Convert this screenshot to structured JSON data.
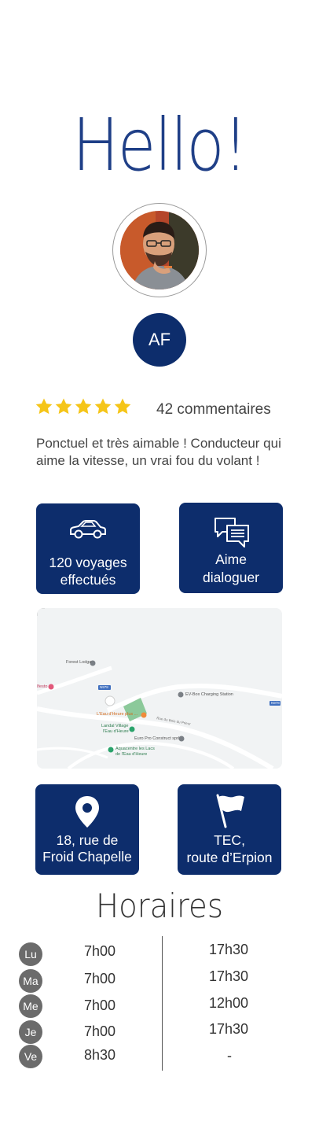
{
  "greeting": "Hello!",
  "profile": {
    "initials": "AF",
    "rating_stars": 5,
    "comments_count": "42 commentaires",
    "review": "Ponctuel et très aimable ! Conducteur qui aime la vitesse, un vrai fou du volant !"
  },
  "stats": {
    "trips_line1": "120 voyages",
    "trips_line2": "effectués",
    "chat_line1": "Aime",
    "chat_line2": "dialoguer"
  },
  "map_labels": {
    "forest_lodge": "Forest Lodge",
    "evbox": "EV-Box Charging Station",
    "eau_heure": "L'Eau d'Heure plus ...",
    "landal": "Landal Village",
    "landal2": "l'Eau d'Heure",
    "euro_pro": "Euro Pro Construct sprl",
    "aquacentre": "Aquacentre les Lacs",
    "aquacentre2": "de l'Eau d'Heure",
    "road_name": "Rue du Bois du Prieur",
    "fast_food": "Ifesto",
    "road_tag1": "N978",
    "road_tag2": "N978"
  },
  "locations": {
    "pickup_line1": "18, rue de",
    "pickup_line2": "Froid Chapelle",
    "dropoff_line1": "TEC,",
    "dropoff_line2": "route d’Erpion"
  },
  "schedule": {
    "title": "Horaires",
    "rows": [
      {
        "day": "Lu",
        "morning": "7h00",
        "evening": "17h30"
      },
      {
        "day": "Ma",
        "morning": "7h00",
        "evening": "17h30"
      },
      {
        "day": "Me",
        "morning": "7h00",
        "evening": "12h00"
      },
      {
        "day": "Je",
        "morning": "7h00",
        "evening": "17h30"
      },
      {
        "day": "Ve",
        "morning": "8h30",
        "evening": "-"
      }
    ]
  },
  "colors": {
    "brand_navy": "#0d2d6c",
    "star_gold": "#f5c518",
    "badge_gray": "#6b6b6b"
  },
  "icons": [
    "car-icon",
    "chat-bubbles-icon",
    "location-pin-icon",
    "flag-icon",
    "star-icon"
  ]
}
